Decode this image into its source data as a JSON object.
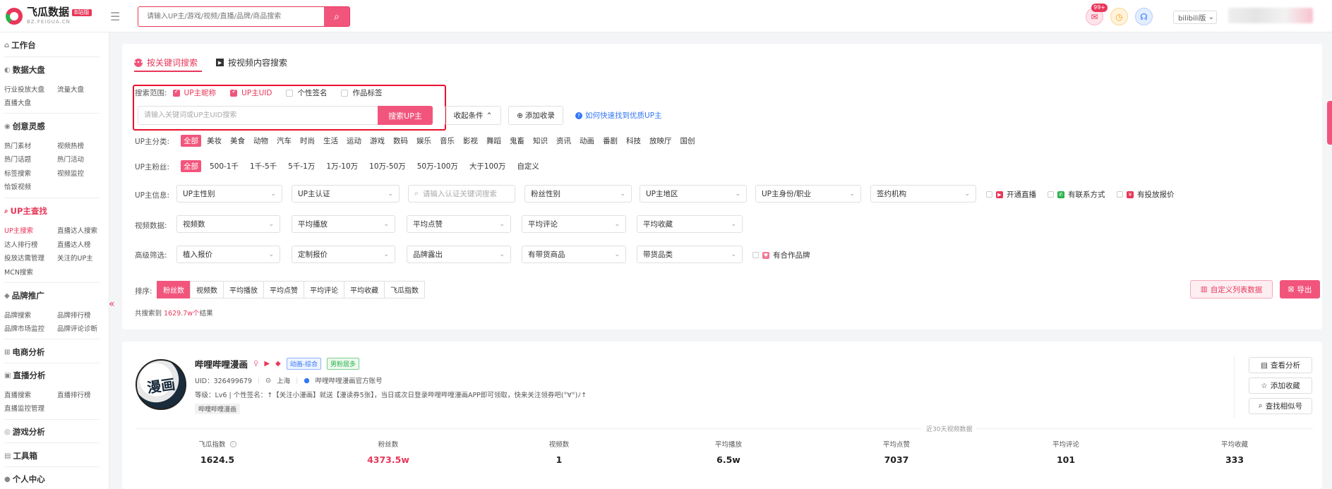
{
  "header": {
    "logo_name": "飞瓜数据",
    "logo_badge": "B站版",
    "logo_sub": "BZ.FEIGUA.CN",
    "search_placeholder": "请输入UP主/游戏/视频/直播/品牌/商品搜索",
    "notif_count": "99+",
    "platform": "bilibili版"
  },
  "sidebar": {
    "sections": [
      {
        "label": "工作台",
        "icon": "home-icon",
        "items": []
      },
      {
        "label": "数据大盘",
        "icon": "chart-icon",
        "items": [
          "行业投放大盘",
          "流量大盘",
          "直播大盘"
        ]
      },
      {
        "label": "创意灵感",
        "icon": "bulb-icon",
        "items": [
          "热门素材",
          "视频热榜",
          "热门话题",
          "热门活动",
          "标签搜索",
          "视频监控",
          "恰饭视频"
        ]
      },
      {
        "label": "UP主查找",
        "icon": "search-icon",
        "items": [
          "UP主搜索",
          "直播达人搜索",
          "达人排行榜",
          "直播达人榜",
          "投放达需管理",
          "关注的UP主",
          "MCN搜索"
        ]
      },
      {
        "label": "品牌推广",
        "icon": "diamond-icon",
        "items": [
          "品牌搜索",
          "品牌排行榜",
          "品牌市场监控",
          "品牌评论诊断"
        ]
      },
      {
        "label": "电商分析",
        "icon": "cart-icon",
        "items": []
      },
      {
        "label": "直播分析",
        "icon": "live-icon",
        "items": [
          "直播搜索",
          "直播排行榜",
          "直播监控管理"
        ]
      },
      {
        "label": "游戏分析",
        "icon": "gamepad-icon",
        "items": []
      },
      {
        "label": "工具箱",
        "icon": "toolbox-icon",
        "items": []
      },
      {
        "label": "个人中心",
        "icon": "user-icon",
        "items": []
      }
    ]
  },
  "tabs": [
    {
      "label": "按关键词搜索",
      "active": true
    },
    {
      "label": "按视频内容搜索",
      "active": false
    }
  ],
  "search": {
    "scope_label": "搜索范围:",
    "scopes": [
      {
        "label": "UP主昵称",
        "checked": true
      },
      {
        "label": "UP主UID",
        "checked": true
      },
      {
        "label": "个性签名",
        "checked": false
      },
      {
        "label": "作品标签",
        "checked": false
      }
    ],
    "input_placeholder": "请输入关键词或UP主UID搜索",
    "button": "搜索UP主",
    "collapse": "收起条件",
    "add_favorite": "添加收录",
    "help_link": "如何快速找到优质UP主"
  },
  "filters": {
    "category_label": "UP主分类:",
    "categories": [
      "全部",
      "美妆",
      "美食",
      "动物",
      "汽车",
      "时尚",
      "生活",
      "运动",
      "游戏",
      "数码",
      "娱乐",
      "音乐",
      "影视",
      "舞蹈",
      "鬼畜",
      "知识",
      "资讯",
      "动画",
      "番剧",
      "科技",
      "放映厅",
      "国创"
    ],
    "fans_label": "UP主粉丝:",
    "fans": [
      "全部",
      "500-1千",
      "1千-5千",
      "5千-1万",
      "1万-10万",
      "10万-50万",
      "50万-100万",
      "大于100万",
      "自定义"
    ],
    "info_label": "UP主信息:",
    "info_selects": [
      "UP主性别",
      "UP主认证",
      "请输入认证关键词搜索",
      "粉丝性别",
      "UP主地区",
      "UP主身份/职业",
      "签约机构"
    ],
    "info_checks": [
      "开通直播",
      "有联系方式",
      "有投放报价"
    ],
    "video_label": "视频数据:",
    "video_selects": [
      "视频数",
      "平均播放",
      "平均点赞",
      "平均评论",
      "平均收藏"
    ],
    "advanced_label": "高级筛选:",
    "advanced_selects": [
      "植入报价",
      "定制报价",
      "品牌露出",
      "有带货商品",
      "带货品类"
    ],
    "advanced_check": "有合作品牌"
  },
  "sort": {
    "label": "排序:",
    "options": [
      "粉丝数",
      "视频数",
      "平均播放",
      "平均点赞",
      "平均评论",
      "平均收藏",
      "飞瓜指数"
    ],
    "active": 0,
    "total_prefix": "共搜索到",
    "total_value": "1629.7w个",
    "total_suffix": "结果",
    "custom_button": "自定义列表数据",
    "export_button": "导出"
  },
  "result": {
    "name": "哔哩哔哩漫画",
    "avatar_text": "漫画",
    "tags": [
      "动画-综合",
      "男粉居多"
    ],
    "uid": "UID：326499679",
    "location": "上海",
    "verify": "哔哩哔哩漫画官方账号",
    "level_line": "等级：Lv6  |  个性签名：↑【关注小漫画】就送【漫读券5张】，当日或次日登录哔哩哔哩漫画APP即可领取，快来关注领券吧(°∀°)ﾉ↑",
    "chip": "哔哩哔哩漫画",
    "actions": [
      "查看分析",
      "添加收藏",
      "查找相似号"
    ],
    "stats_caption": "近30天视频数据",
    "stats": [
      {
        "label": "飞瓜指数",
        "value": "1624.5"
      },
      {
        "label": "粉丝数",
        "value": "4373.5w"
      },
      {
        "label": "视频数",
        "value": "1"
      },
      {
        "label": "平均播放",
        "value": "6.5w"
      },
      {
        "label": "平均点赞",
        "value": "7037"
      },
      {
        "label": "平均评论",
        "value": "101"
      },
      {
        "label": "平均收藏",
        "value": "333"
      }
    ]
  },
  "colors": {
    "accent": "#e8375a",
    "accent_fill": "#f2557c",
    "link": "#3477f5"
  }
}
